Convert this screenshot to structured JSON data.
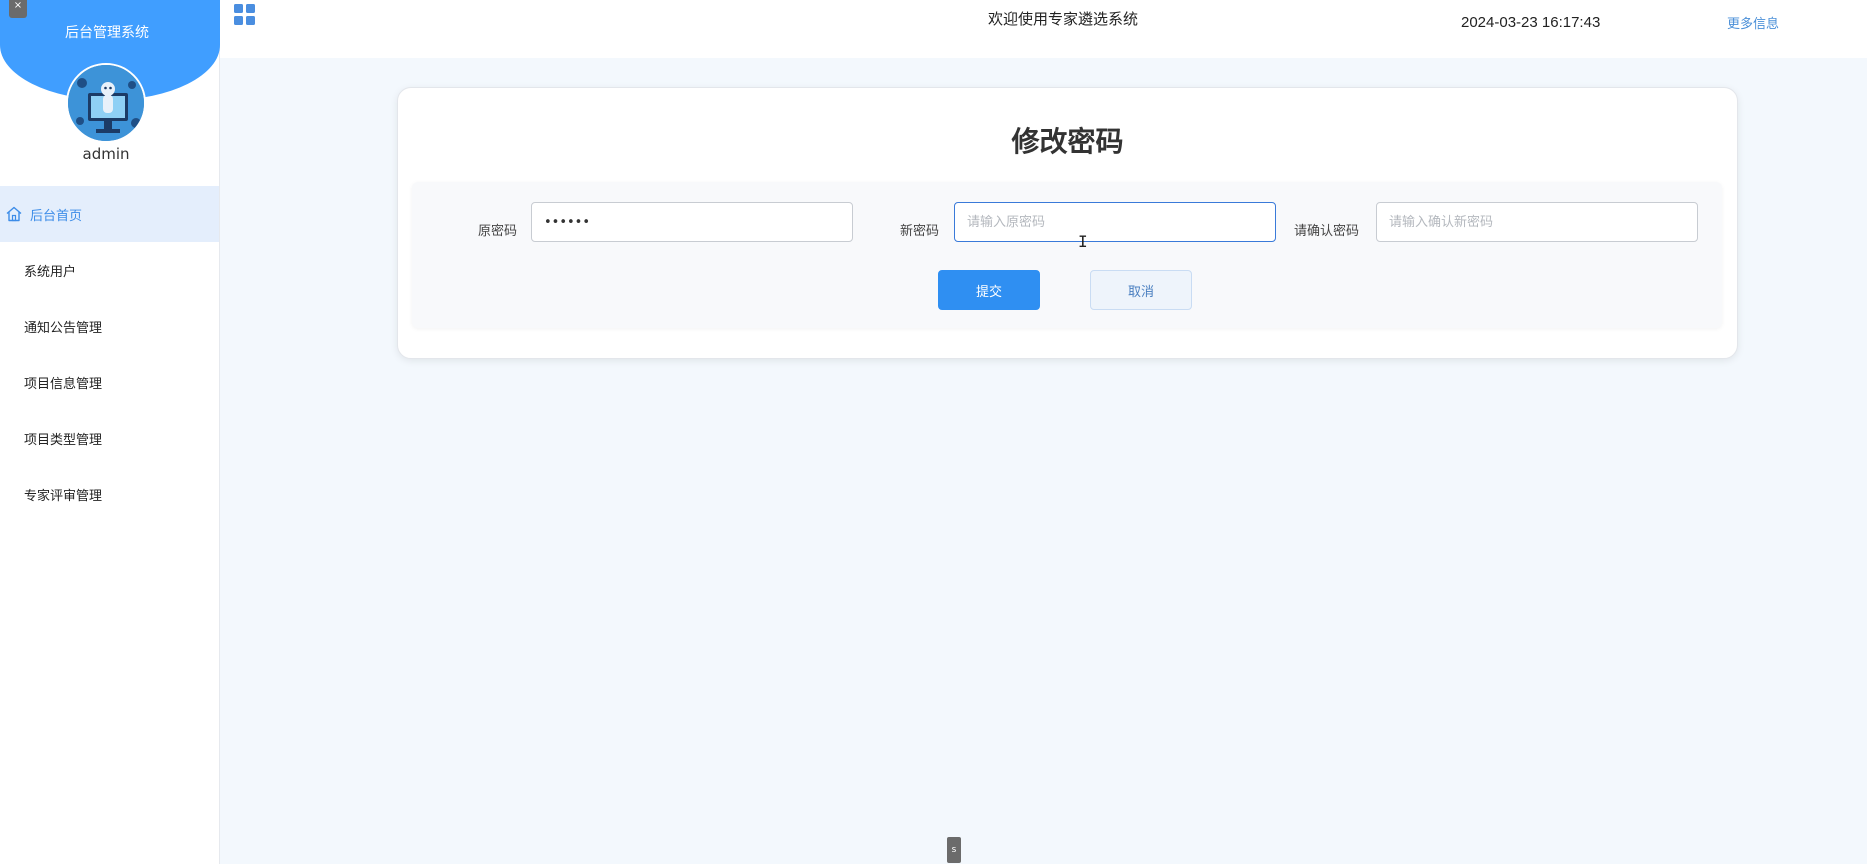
{
  "sidebar": {
    "system_name": "后台管理系统",
    "close_tab": "×",
    "username": "admin",
    "items": [
      {
        "label": "后台首页",
        "active": true
      },
      {
        "label": "系统用户"
      },
      {
        "label": "通知公告管理"
      },
      {
        "label": "项目信息管理"
      },
      {
        "label": "项目类型管理"
      },
      {
        "label": "专家评审管理"
      }
    ]
  },
  "header": {
    "welcome": "欢迎使用专家遴选系统",
    "datetime": "2024-03-23 16:17:43",
    "more_info": "更多信息"
  },
  "form": {
    "title": "修改密码",
    "old_password": {
      "label": "原密码",
      "value": "••••••"
    },
    "new_password": {
      "label": "新密码",
      "placeholder": "请输入原密码"
    },
    "confirm_password": {
      "label": "请确认密码",
      "placeholder": "请输入确认新密码"
    },
    "submit_label": "提交",
    "cancel_label": "取消"
  },
  "bottom_badge": "s",
  "colors": {
    "accent": "#409eff",
    "submit": "#2f8ff2",
    "active_menu_bg": "#e4eefc",
    "page_bg": "#f3f8fd"
  }
}
